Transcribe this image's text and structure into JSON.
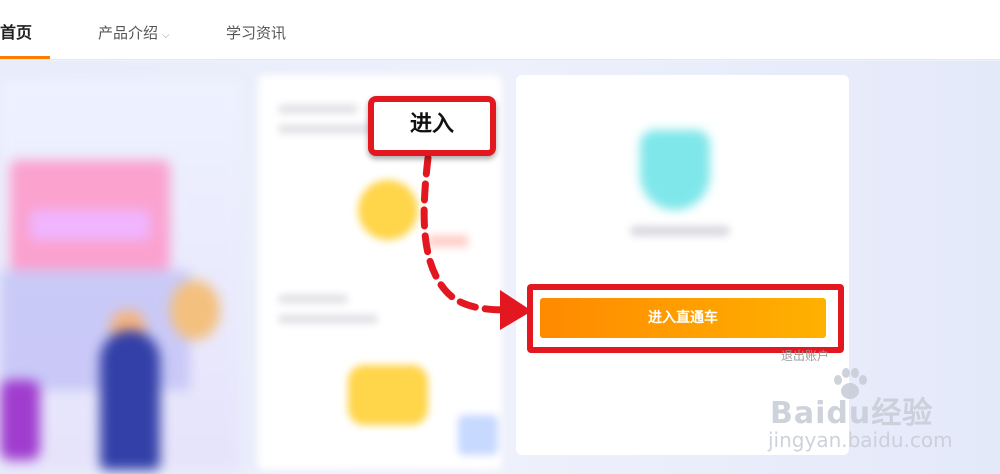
{
  "nav": {
    "home": "首页",
    "product": "产品介绍",
    "learn": "学习资讯"
  },
  "card": {
    "enter_button": "进入直通车",
    "logout": "退出账户"
  },
  "annotation": {
    "callout": "进入"
  },
  "watermark": {
    "logo": "Baidu经验",
    "url": "jingyan.baidu.com"
  },
  "colors": {
    "accent": "#ff8a00",
    "highlight": "#e3171f"
  }
}
